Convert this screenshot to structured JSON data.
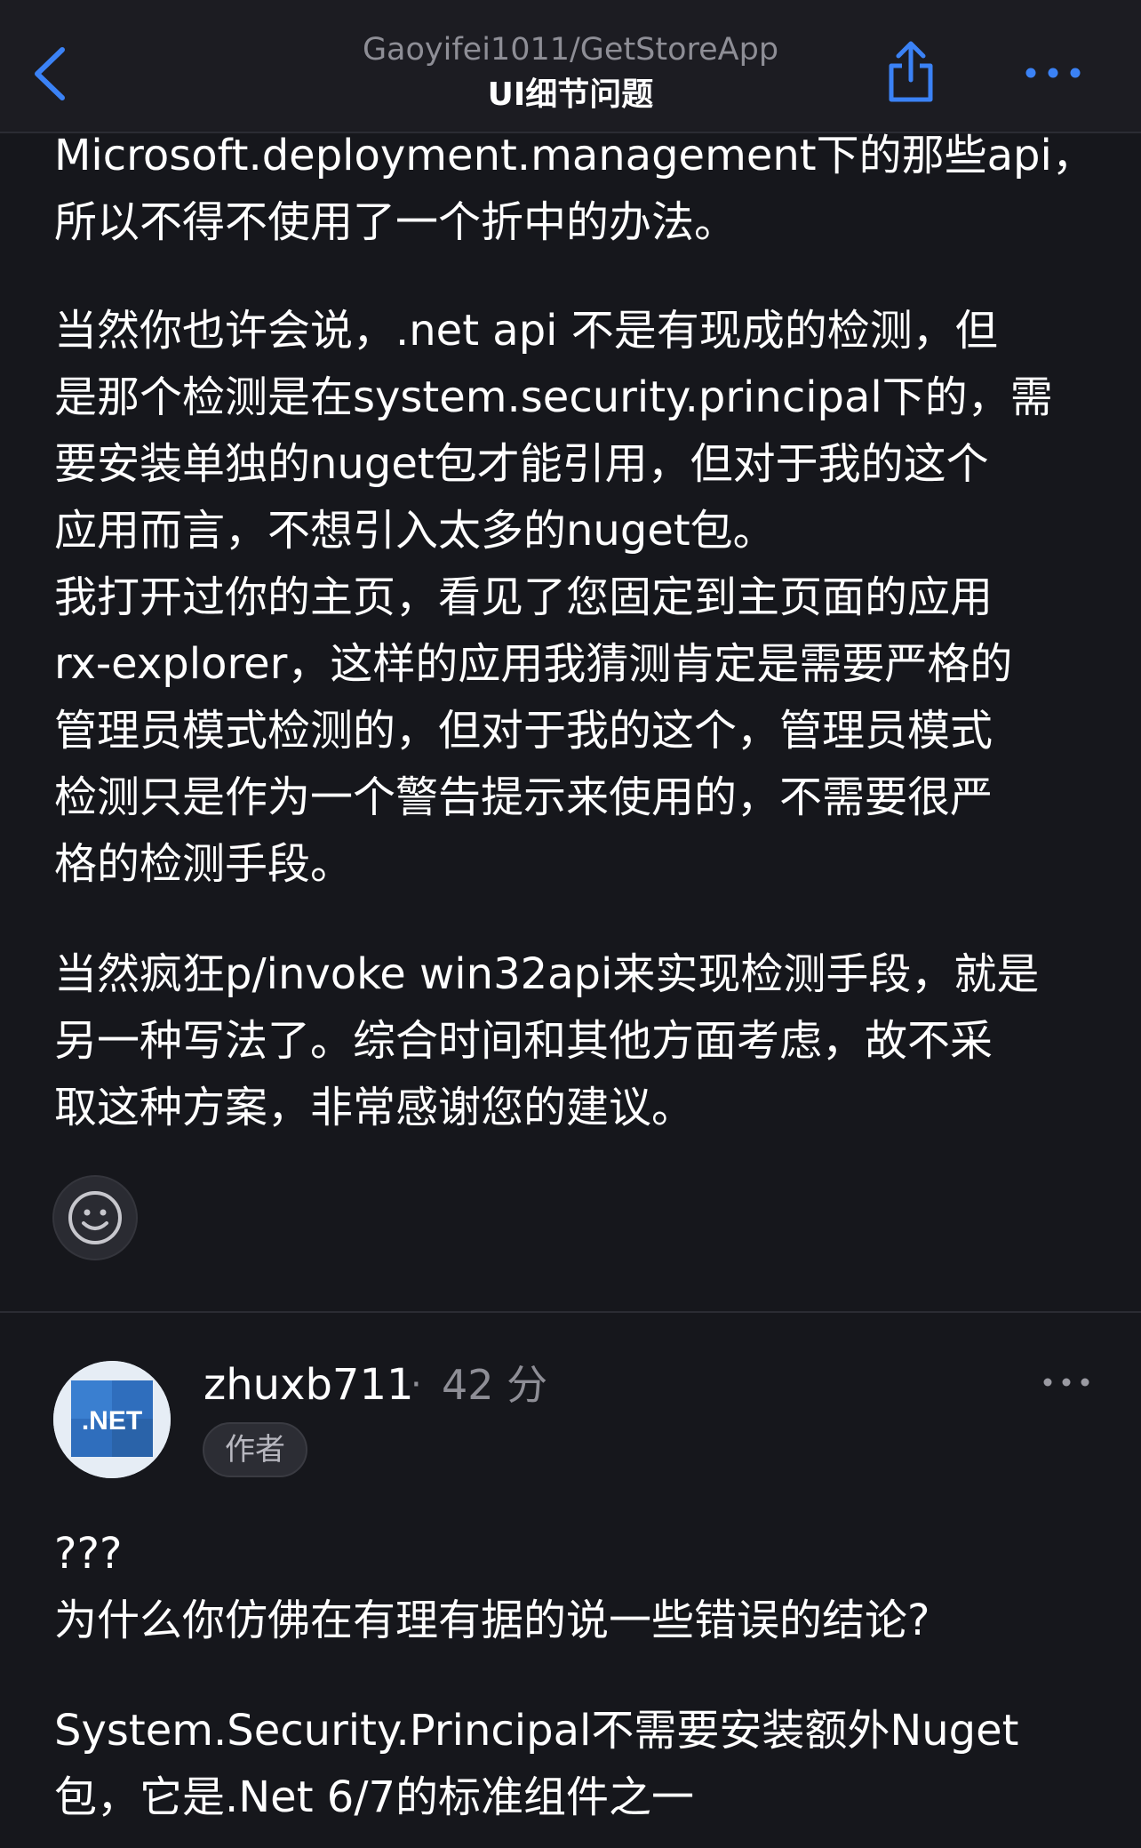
{
  "header": {
    "repo": "Gaoyifei1011/GetStoreApp",
    "issue_title": "UI细节问题",
    "back_icon": "chevron-left-icon",
    "share_icon": "share-icon",
    "more_icon": "ellipsis-icon",
    "accent_color": "#3b82f6"
  },
  "previous_comment": {
    "paragraphs": [
      {
        "lines": [
          "Microsoft.deployment.management下的那些api，",
          "所以不得不使用了一个折中的办法。"
        ]
      },
      {
        "lines": [
          "当然你也许会说，.net api 不是有现成的检测，但",
          "是那个检测是在system.security.principal下的，需",
          "要安装单独的nuget包才能引用，但对于我的这个",
          "应用而言，不想引入太多的nuget包。",
          "我打开过你的主页，看见了您固定到主页面的应用",
          "rx-explorer，这样的应用我猜测肯定是需要严格的",
          "管理员模式检测的，但对于我的这个，管理员模式",
          "检测只是作为一个警告提示来使用的，不需要很严",
          "格的检测手段。"
        ]
      },
      {
        "lines": [
          "当然疯狂p/invoke win32api来实现检测手段，就是",
          "另一种写法了。综合时间和其他方面考虑，故不采",
          "取这种方案，非常感谢您的建议。"
        ]
      }
    ],
    "reaction_icon": "smiley-icon"
  },
  "comment": {
    "username": "zhuxb711",
    "separator": "·",
    "time": "42 分",
    "badge": "作者",
    "avatar_text": ".NET",
    "more_icon": "ellipsis-icon",
    "paragraphs": [
      {
        "lines": [
          "???",
          "为什么你仿佛在有理有据的说一些错误的结论?"
        ]
      },
      {
        "lines": [
          "System.Security.Principal不需要安装额外Nuget",
          "包，它是.Net 6/7的标准组件之一"
        ]
      }
    ]
  }
}
